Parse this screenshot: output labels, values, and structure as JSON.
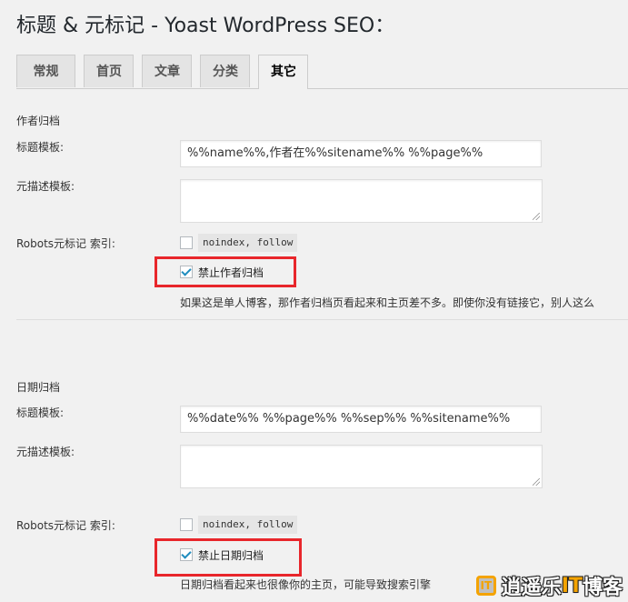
{
  "page": {
    "title": "标题 & 元标记 - Yoast WordPress SEO："
  },
  "tabs": [
    {
      "label": "常规"
    },
    {
      "label": "首页"
    },
    {
      "label": "文章"
    },
    {
      "label": "分类"
    },
    {
      "label": "其它",
      "active": true
    }
  ],
  "author_archive": {
    "section_title": "作者归档",
    "title_template_label": "标题模板:",
    "title_template_value": "%%name%%,作者在%%sitename%% %%page%%",
    "meta_desc_label": "元描述模板:",
    "meta_desc_value": "",
    "robots_label": "Robots元标记 索引:",
    "noindex_code": "noindex, follow",
    "noindex_checked": false,
    "disable_label": "禁止作者归档",
    "disable_checked": true,
    "description": "如果这是单人博客，那作者归档页看起来和主页差不多。即使你没有链接它，别人这么"
  },
  "date_archive": {
    "section_title": "日期归档",
    "title_template_label": "标题模板:",
    "title_template_value": "%%date%% %%page%% %%sep%% %%sitename%%",
    "meta_desc_label": "元描述模板:",
    "meta_desc_value": "",
    "robots_label": "Robots元标记 索引:",
    "noindex_code": "noindex, follow",
    "noindex_checked": false,
    "disable_label": "禁止日期归档",
    "disable_checked": true,
    "description": "日期归档看起来也很像你的主页，可能导致搜索引擎"
  },
  "watermark": {
    "text_a": "逍遥乐",
    "text_it": "IT",
    "text_b": "博客"
  },
  "colors": {
    "highlight_red": "#e8262b",
    "checkbox_blue": "#1e8cbe",
    "watermark_orange": "#f4a300"
  }
}
